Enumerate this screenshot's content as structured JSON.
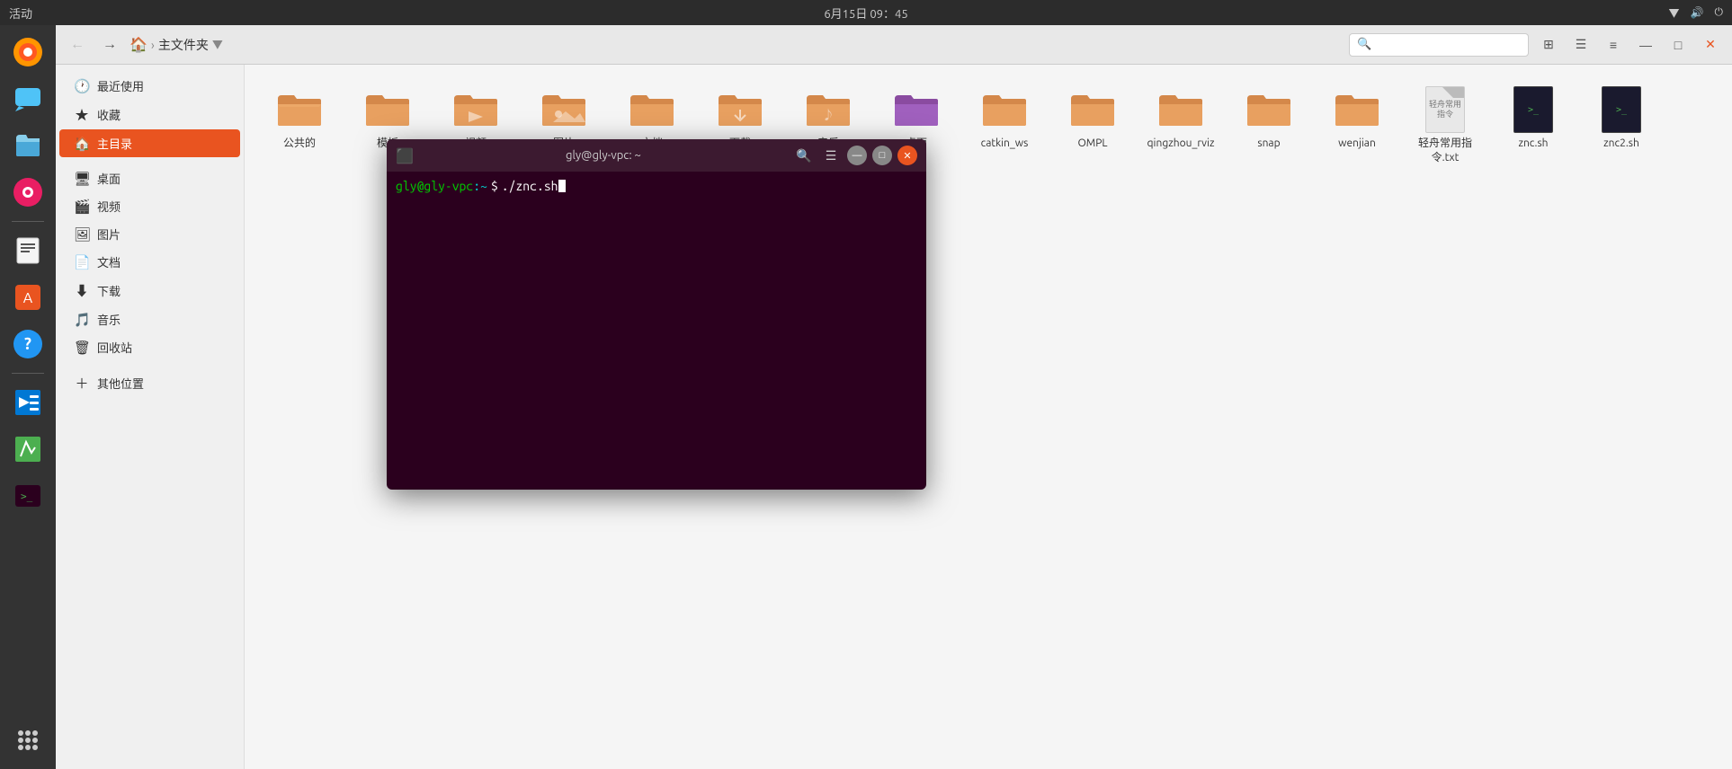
{
  "topbar": {
    "left_label": "活动",
    "center_text": "6月15日 09：45",
    "right_items": [
      "",
      "",
      "",
      "",
      ""
    ]
  },
  "dock": {
    "items": [
      {
        "name": "firefox-icon",
        "label": "Firefox"
      },
      {
        "name": "chat-icon",
        "label": "消息"
      },
      {
        "name": "files-icon",
        "label": "文件"
      },
      {
        "name": "rhythmbox-icon",
        "label": "音乐"
      },
      {
        "name": "text-editor-icon",
        "label": "文本"
      },
      {
        "name": "appstore-icon",
        "label": "软件"
      },
      {
        "name": "help-icon",
        "label": "帮助"
      },
      {
        "name": "vscode-icon",
        "label": "VSCode"
      },
      {
        "name": "editor2-icon",
        "label": "编辑器"
      },
      {
        "name": "terminal-icon",
        "label": "终端"
      }
    ],
    "show_apps_label": "显示应用"
  },
  "file_manager": {
    "title": "主文件夹",
    "breadcrumb": [
      "主文件夹"
    ],
    "sidebar": {
      "recent_label": "最近使用",
      "starred_label": "收藏",
      "home_label": "主目录",
      "items": [
        {
          "id": "desktop",
          "label": "桌面",
          "icon": "desktop"
        },
        {
          "id": "video",
          "label": "视频",
          "icon": "video"
        },
        {
          "id": "picture",
          "label": "图片",
          "icon": "picture"
        },
        {
          "id": "document",
          "label": "文档",
          "icon": "document"
        },
        {
          "id": "download",
          "label": "下载",
          "icon": "download"
        },
        {
          "id": "music",
          "label": "音乐",
          "icon": "music"
        },
        {
          "id": "trash",
          "label": "回收站",
          "icon": "trash"
        },
        {
          "id": "other",
          "label": "其他位置",
          "icon": "other"
        }
      ]
    },
    "files": [
      {
        "name": "公共的",
        "type": "folder",
        "color": "#b5651d"
      },
      {
        "name": "模板",
        "type": "folder",
        "color": "#b5651d"
      },
      {
        "name": "视频",
        "type": "folder",
        "color": "#b5651d"
      },
      {
        "name": "图片",
        "type": "folder",
        "color": "#b5651d"
      },
      {
        "name": "文档",
        "type": "folder",
        "color": "#b5651d"
      },
      {
        "name": "下载",
        "type": "folder",
        "color": "#b5651d"
      },
      {
        "name": "音乐",
        "type": "folder",
        "color": "#b5651d"
      },
      {
        "name": "桌面",
        "type": "folder",
        "color": "#9b59b6"
      },
      {
        "name": "catkin_ws",
        "type": "folder",
        "color": "#b5651d"
      },
      {
        "name": "OMPL",
        "type": "folder",
        "color": "#b5651d"
      },
      {
        "name": "qingzhou_rviz",
        "type": "folder",
        "color": "#b5651d"
      },
      {
        "name": "snap",
        "type": "folder",
        "color": "#b5651d"
      },
      {
        "name": "wenjian",
        "type": "folder",
        "color": "#b5651d"
      },
      {
        "name": "轻舟常用指令.txt",
        "type": "txt"
      },
      {
        "name": "znc.sh",
        "type": "sh"
      },
      {
        "name": "znc2.sh",
        "type": "sh"
      }
    ]
  },
  "terminal": {
    "title": "gly@gly-vpc: ~",
    "prompt_user": "gly@gly-vpc",
    "prompt_path": ":~",
    "prompt_dollar": "$",
    "command": "./znc.sh"
  }
}
